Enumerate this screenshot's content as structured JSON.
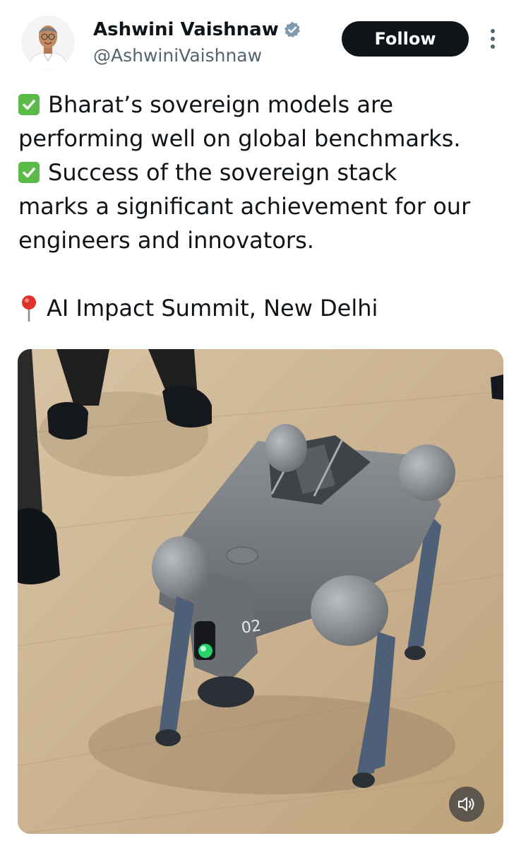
{
  "author": {
    "name": "Ashwini Vaishnaw",
    "handle": "@AshwiniVaishnaw",
    "verified_icon": "verified-badge-icon"
  },
  "actions": {
    "follow_label": "Follow",
    "more_icon": "more-vertical-icon"
  },
  "tweet": {
    "line1": "Bharat’s sovereign models are",
    "line2": "performing well on global benchmarks.",
    "line3": "Success of the sovereign stack",
    "line4": "marks a significant achievement for our",
    "line5": "engineers and innovators.",
    "line6": "AI Impact Summit, New Delhi"
  },
  "media": {
    "robot_label": "02",
    "sound_icon": "speaker-muted-icon"
  },
  "colors": {
    "follow_bg": "#0f1419",
    "verified": "#829aab",
    "check": "#5aba4a",
    "pin": "#e0322b",
    "handle": "#536471"
  }
}
